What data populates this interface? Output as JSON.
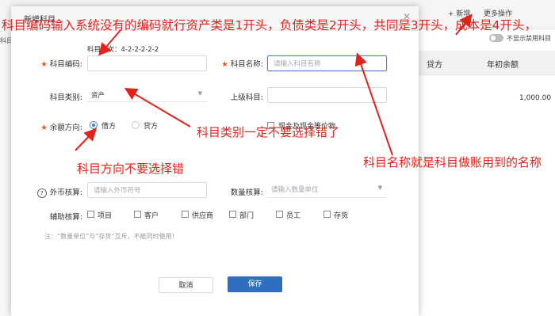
{
  "background": {
    "toolbar": {
      "add_label": "+ 新增",
      "more_label": "更多操作",
      "toggle_label": "不显示禁用科目"
    },
    "columns": [
      "贷方",
      "年初余额"
    ],
    "cell_value": "1,000.00",
    "left_text": "科目"
  },
  "modal": {
    "title": "新增科目",
    "level_hint": "科目级次：4-2-2-2-2-2",
    "fields": {
      "code_label": "科目编码:",
      "name_label": "科目名称:",
      "name_placeholder": "请输入科目名称",
      "category_label": "科目类别:",
      "category_value": "资产",
      "parent_label": "上级科目:",
      "direction_label": "余额方向:",
      "direction_debit": "借方",
      "direction_credit": "贷方",
      "cash_label": "现金及现金等价物",
      "currency_label": "外币核算:",
      "currency_placeholder": "请输入外币符号",
      "quantity_label": "数量核算:",
      "quantity_placeholder": "请输入数量单位",
      "aux_label": "辅助核算:",
      "aux_items": [
        "项目",
        "客户",
        "供应商",
        "部门",
        "员工",
        "存货"
      ]
    },
    "note": "注：“数量单位”与“存货”互斥，不能同时使用！",
    "cancel_label": "取消",
    "save_label": "保存"
  },
  "annotations": {
    "top": "科目编码输入系统没有的编码就行资产类是1开头，负债类是2开头，共同是3开头，成本是4开头，",
    "category": "科目类别一定不要选择错了",
    "direction": "科目方向不要选择错",
    "name": "科目名称就是科目做账用到的名称",
    "color": "#e2221b"
  }
}
